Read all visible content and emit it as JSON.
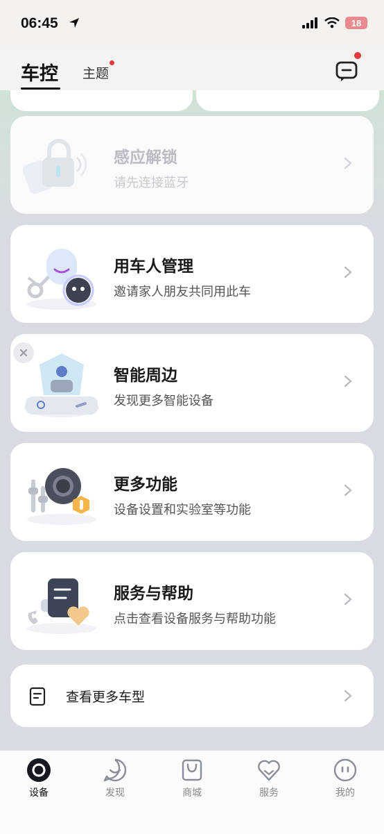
{
  "status_bar": {
    "time": "06:45",
    "battery": "18"
  },
  "header": {
    "tabs": [
      {
        "label": "车控",
        "active": true
      },
      {
        "label": "主题",
        "badge": true
      }
    ]
  },
  "cards": [
    {
      "title": "感应解锁",
      "subtitle": "请先连接蓝牙",
      "disabled": true
    },
    {
      "title": "用车人管理",
      "subtitle": "邀请家人朋友共同用此车"
    },
    {
      "title": "智能周边",
      "subtitle": "发现更多智能设备",
      "dismissible": true
    },
    {
      "title": "更多功能",
      "subtitle": "设备设置和实验室等功能"
    },
    {
      "title": "服务与帮助",
      "subtitle": "点击查看设备服务与帮助功能"
    }
  ],
  "more_models": {
    "label": "查看更多车型"
  },
  "bottom_nav": [
    {
      "label": "设备",
      "icon": "device-icon",
      "active": true
    },
    {
      "label": "发现",
      "icon": "discover-icon"
    },
    {
      "label": "商城",
      "icon": "shop-icon"
    },
    {
      "label": "服务",
      "icon": "service-icon"
    },
    {
      "label": "我的",
      "icon": "profile-icon"
    }
  ],
  "colors": {
    "accent_dot": "#e0383e",
    "background": "#d9dbe2",
    "card": "#ffffff"
  }
}
